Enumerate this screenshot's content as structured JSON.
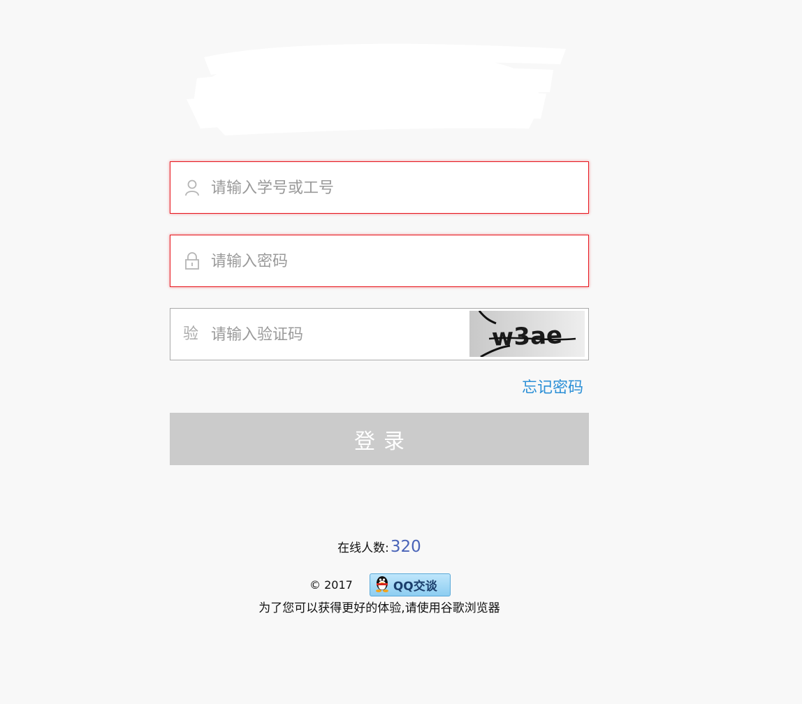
{
  "login": {
    "username_placeholder": "请输入学号或工号",
    "password_placeholder": "请输入密码",
    "captcha_prefix": "验",
    "captcha_placeholder": "请输入验证码",
    "captcha_text": "w3ae",
    "forgot_password": "忘记密码",
    "submit_label": "登录"
  },
  "online": {
    "label": "在线人数:",
    "count": "320"
  },
  "footer": {
    "copyright": "© 2017",
    "qq_button_label": "QQ交谈",
    "browser_hint": "为了您可以获得更好的体验,请使用谷歌浏览器"
  },
  "icons": {
    "user": "user-icon",
    "lock": "lock-icon",
    "qq": "qq-penguin-icon"
  },
  "colors": {
    "page_bg": "#f8f8f8",
    "error_border": "#e8141c",
    "link": "#2b8fd6",
    "button_disabled": "#cbcbcb",
    "online_count": "#4a64b8"
  }
}
